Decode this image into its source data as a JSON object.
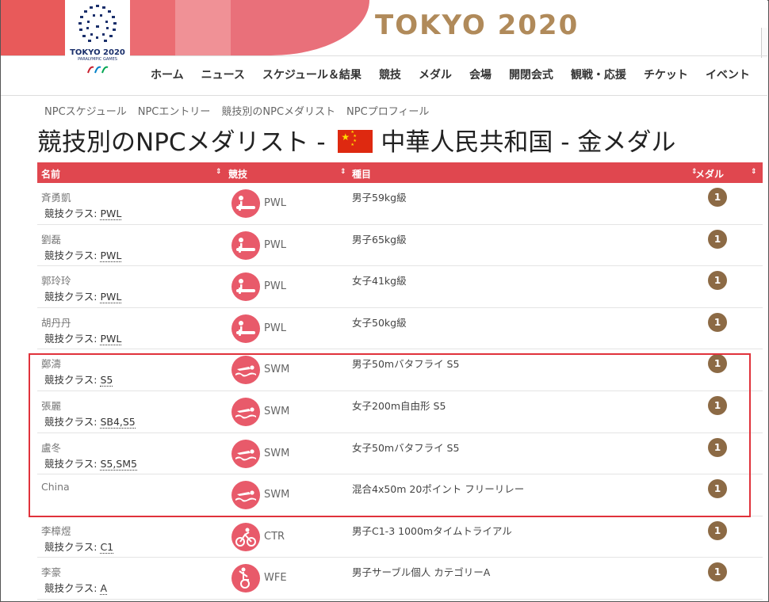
{
  "brand": {
    "title": "TOKYO 2020",
    "logo_line1": "TOKYO 2020",
    "logo_line2": "PARALYMPIC GAMES"
  },
  "nav": [
    "ホーム",
    "ニュース",
    "スケジュール＆結果",
    "競技",
    "メダル",
    "会場",
    "開閉会式",
    "観戦・応援",
    "チケット",
    "イベント"
  ],
  "subnav": [
    "NPCスケジュール",
    "NPCエントリー",
    "競技別のNPCメダリスト",
    "NPCプロフィール"
  ],
  "page_title": {
    "prefix": "競技別のNPCメダリスト - ",
    "country": "中華人民共和国",
    "suffix": " - 金メダル"
  },
  "table": {
    "headers": {
      "name": "名前",
      "sport": "競技",
      "event": "種目",
      "medal": "メダル"
    },
    "sort_icon": "⇕",
    "class_label": "競技クラス: ",
    "medal_glyph": "1",
    "rows": [
      {
        "name": "斉勇凱",
        "class": "PWL",
        "sport_icon": "powerlifting-icon",
        "sport": "PWL",
        "event": "男子59kg級"
      },
      {
        "name": "劉磊",
        "class": "PWL",
        "sport_icon": "powerlifting-icon",
        "sport": "PWL",
        "event": "男子65kg級"
      },
      {
        "name": "郭玲玲",
        "class": "PWL",
        "sport_icon": "powerlifting-icon",
        "sport": "PWL",
        "event": "女子41kg級"
      },
      {
        "name": "胡丹丹",
        "class": "PWL",
        "sport_icon": "powerlifting-icon",
        "sport": "PWL",
        "event": "女子50kg級"
      },
      {
        "name": "鄭濤",
        "class": "S5",
        "sport_icon": "swimming-icon",
        "sport": "SWM",
        "event": "男子50mバタフライ S5"
      },
      {
        "name": "張麗",
        "class": "SB4,S5",
        "sport_icon": "swimming-icon",
        "sport": "SWM",
        "event": "女子200m自由形 S5"
      },
      {
        "name": "盧冬",
        "class": "S5,SM5",
        "sport_icon": "swimming-icon",
        "sport": "SWM",
        "event": "女子50mバタフライ S5"
      },
      {
        "name": "China",
        "class": "",
        "sport_icon": "swimming-icon",
        "sport": "SWM",
        "event": "混合4x50m 20ポイント フリーリレー"
      },
      {
        "name": "李樟煜",
        "class": "C1",
        "sport_icon": "cycling-track-icon",
        "sport": "CTR",
        "event": "男子C1-3 1000mタイムトライアル"
      },
      {
        "name": "李豪",
        "class": "A",
        "sport_icon": "wheelchair-fencing-icon",
        "sport": "WFE",
        "event": "男子サーブル個人 カテゴリーA"
      }
    ]
  },
  "colors": {
    "header_red": "#e0474f",
    "sport_icon_bg": "#e85a6a",
    "gold_medal": "#8c6a45",
    "brand_gold": "#b08a5a",
    "highlight": "#e0323b"
  }
}
